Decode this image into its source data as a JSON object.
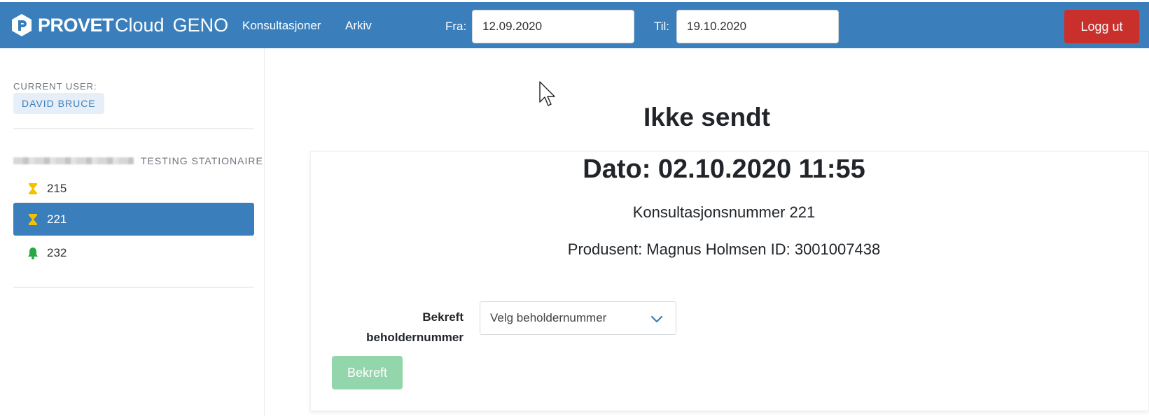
{
  "header": {
    "brand_provet": "PROVET",
    "brand_cloud": "Cloud",
    "brand_app": "GENO",
    "nav": [
      {
        "label": "Konsultasjoner"
      },
      {
        "label": "Arkiv"
      }
    ],
    "from_label": "Fra:",
    "from_value": "12.09.2020",
    "to_label": "Til:",
    "to_value": "19.10.2020",
    "logout_label": "Logg ut",
    "colors": {
      "navbar": "#3a7fbb",
      "logout": "#c9302c"
    }
  },
  "sidebar": {
    "current_user_label": "CURRENT USER:",
    "current_user_name": "DAVID BRUCE",
    "clinic_name": "TESTING STATIONAIRE",
    "items": [
      {
        "label": "215",
        "icon": "hourglass-icon",
        "active": false
      },
      {
        "label": "221",
        "icon": "hourglass-icon",
        "active": true
      },
      {
        "label": "232",
        "icon": "bell-icon",
        "active": false
      }
    ]
  },
  "main": {
    "title": "Ikke sendt",
    "dato": "Dato: 02.10.2020 11:55",
    "konsultasjon": "Konsultasjonsnummer 221",
    "produsent": "Produsent: Magnus Holmsen ID: 3001007438",
    "confirm_label_line1": "Bekreft",
    "confirm_label_line2": "beholdernummer",
    "select_placeholder": "Velg beholdernummer",
    "confirm_button": "Bekreft",
    "colors": {
      "confirm_button": "#94d6ab",
      "hourglass": "#f2c200",
      "bell": "#28a745"
    }
  }
}
